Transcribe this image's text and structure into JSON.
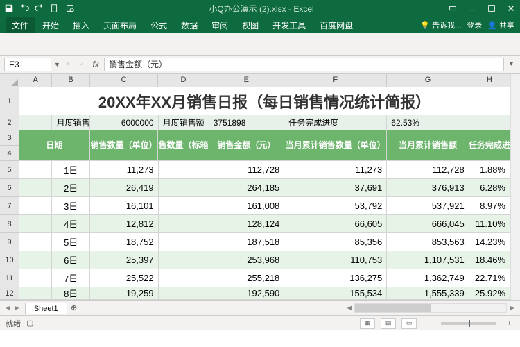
{
  "app": {
    "title": "小Q办公演示 (2).xlsx - Excel"
  },
  "ribbon": {
    "file": "文件",
    "tabs": [
      "开始",
      "插入",
      "页面布局",
      "公式",
      "数据",
      "审阅",
      "视图",
      "开发工具",
      "百度网盘"
    ],
    "tell": "告诉我...",
    "login": "登录",
    "share": "共享"
  },
  "formula": {
    "cellref": "E3",
    "value": "销售金额（元）"
  },
  "cols": [
    "A",
    "B",
    "C",
    "D",
    "E",
    "F",
    "G",
    "H"
  ],
  "title_text": "20XX年XX月销售日报（每日销售情况统计简报）",
  "summary": {
    "l1": "月度销售任务",
    "v1": "6000000",
    "l2": "月度销售额",
    "v2": "3751898",
    "l3": "任务完成进度",
    "v3": "62.53%"
  },
  "headers": {
    "a": "日期",
    "b": "销售数量（单位）",
    "c": "销售数量（标箱）",
    "d": "销售金额（元）",
    "e": "当月累计销售数量（单位）",
    "f": "当月累计销售额",
    "g": "任务完成进"
  },
  "rows": [
    {
      "d": "1日",
      "q": "11,273",
      "amt": "112,728",
      "cq": "11,273",
      "ca": "112,728",
      "p": "1.88%"
    },
    {
      "d": "2日",
      "q": "26,419",
      "amt": "264,185",
      "cq": "37,691",
      "ca": "376,913",
      "p": "6.28%"
    },
    {
      "d": "3日",
      "q": "16,101",
      "amt": "161,008",
      "cq": "53,792",
      "ca": "537,921",
      "p": "8.97%"
    },
    {
      "d": "4日",
      "q": "12,812",
      "amt": "128,124",
      "cq": "66,605",
      "ca": "666,045",
      "p": "11.10%"
    },
    {
      "d": "5日",
      "q": "18,752",
      "amt": "187,518",
      "cq": "85,356",
      "ca": "853,563",
      "p": "14.23%"
    },
    {
      "d": "6日",
      "q": "25,397",
      "amt": "253,968",
      "cq": "110,753",
      "ca": "1,107,531",
      "p": "18.46%"
    },
    {
      "d": "7日",
      "q": "25,522",
      "amt": "255,218",
      "cq": "136,275",
      "ca": "1,362,749",
      "p": "22.71%"
    },
    {
      "d": "8日",
      "q": "19,259",
      "amt": "192,590",
      "cq": "155,534",
      "ca": "1,555,339",
      "p": "25.92%"
    }
  ],
  "sheet": {
    "name": "Sheet1"
  },
  "status": {
    "ready": "就绪"
  },
  "chart_data": {
    "type": "table",
    "title": "20XX年XX月销售日报（每日销售情况统计简报）",
    "summary": {
      "月度销售任务": 6000000,
      "月度销售额": 3751898,
      "任务完成进度": 0.6253
    },
    "columns": [
      "日期",
      "销售数量（单位）",
      "销售数量（标箱）",
      "销售金额（元）",
      "当月累计销售数量（单位）",
      "当月累计销售额",
      "任务完成进度"
    ],
    "data": [
      [
        "1日",
        11273,
        null,
        112728,
        11273,
        112728,
        0.0188
      ],
      [
        "2日",
        26419,
        null,
        264185,
        37691,
        376913,
        0.0628
      ],
      [
        "3日",
        16101,
        null,
        161008,
        53792,
        537921,
        0.0897
      ],
      [
        "4日",
        12812,
        null,
        128124,
        66605,
        666045,
        0.111
      ],
      [
        "5日",
        18752,
        null,
        187518,
        85356,
        853563,
        0.1423
      ],
      [
        "6日",
        25397,
        null,
        253968,
        110753,
        1107531,
        0.1846
      ],
      [
        "7日",
        25522,
        null,
        255218,
        136275,
        1362749,
        0.2271
      ],
      [
        "8日",
        19259,
        null,
        192590,
        155534,
        1555339,
        0.2592
      ]
    ]
  }
}
